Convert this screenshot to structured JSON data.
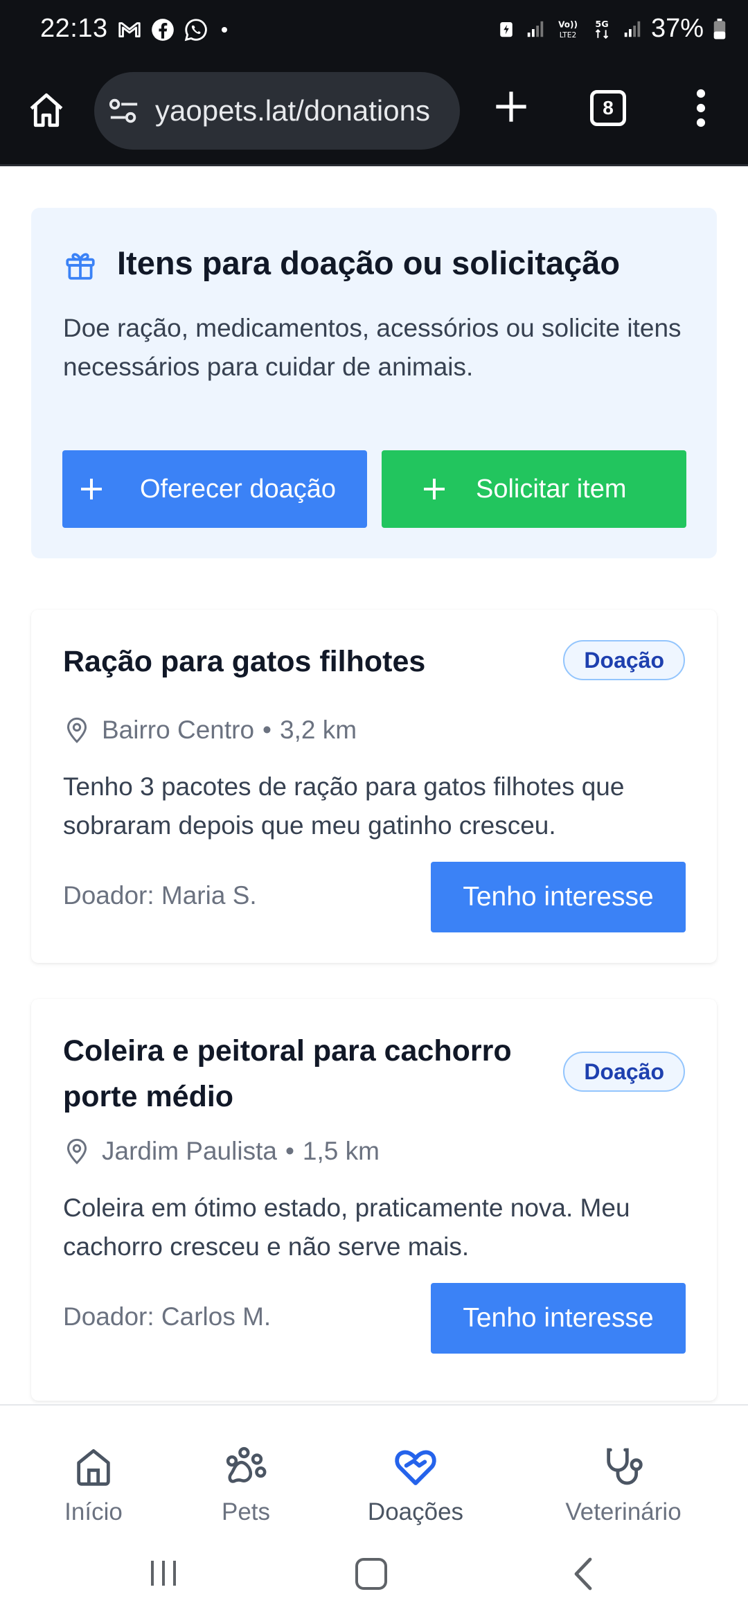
{
  "status_bar": {
    "time": "22:13",
    "battery": "37%",
    "left_icons": [
      "gmail-icon",
      "facebook-icon",
      "whatsapp-icon",
      "dot-icon"
    ],
    "right_icons": [
      "battery-saver-icon",
      "signal-icon",
      "volte-icon",
      "5g-icon",
      "signal-icon",
      "battery-icon"
    ]
  },
  "browser": {
    "url": "yaopets.lat/donations",
    "tab_count": "8"
  },
  "hero": {
    "title": "Itens para doação ou solicitação",
    "description": "Doe ração, medicamentos, acessórios ou solicite itens necessários para cuidar de animais.",
    "offer_button": "Oferecer doação",
    "request_button": "Solicitar item",
    "colors": {
      "offer": "#3b82f6",
      "request": "#22c55e",
      "background": "#eef5fe"
    }
  },
  "listings": [
    {
      "title": "Ração para gatos filhotes",
      "badge": "Doação",
      "location": "Bairro Centro",
      "distance": "3,2 km",
      "description": "Tenho 3 pacotes de ração para gatos filhotes que sobraram depois que meu gatinho cresceu.",
      "donor": "Doador: Maria S.",
      "action": "Tenho interesse"
    },
    {
      "title": "Coleira e peitoral para cachorro porte médio",
      "badge": "Doação",
      "location": "Jardim Paulista",
      "distance": "1,5 km",
      "description": "Coleira em ótimo estado, praticamente nova. Meu cachorro cresceu e não serve mais.",
      "donor": "Doador: Carlos M.",
      "action": "Tenho interesse"
    }
  ],
  "bottom_nav": {
    "items": [
      {
        "label": "Início",
        "icon": "home-icon"
      },
      {
        "label": "Pets",
        "icon": "paw-icon"
      },
      {
        "label": "Doações",
        "icon": "heart-hand-icon",
        "active": true
      },
      {
        "label": "Veterinário",
        "icon": "stethoscope-icon"
      }
    ],
    "active_color": "#2563eb"
  }
}
